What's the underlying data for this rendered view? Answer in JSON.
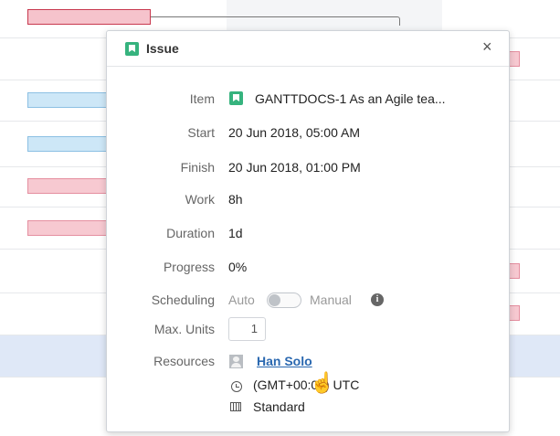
{
  "dialog": {
    "title": "Issue",
    "close_label": "×"
  },
  "fields": {
    "item": {
      "label": "Item",
      "value": "GANTTDOCS-1 As an Agile tea..."
    },
    "start": {
      "label": "Start",
      "value": "20 Jun 2018, 05:00 AM"
    },
    "finish": {
      "label": "Finish",
      "value": "20 Jun 2018, 01:00 PM"
    },
    "work": {
      "label": "Work",
      "value": "8h"
    },
    "duration": {
      "label": "Duration",
      "value": "1d"
    },
    "progress": {
      "label": "Progress",
      "value": "0%"
    },
    "scheduling": {
      "label": "Scheduling",
      "auto": "Auto",
      "manual": "Manual"
    },
    "max_units": {
      "label": "Max. Units",
      "value": "1"
    },
    "resources": {
      "label": "Resources",
      "name": "Han Solo",
      "timezone": "(GMT+00:00) UTC",
      "calendar": "Standard"
    }
  },
  "colors": {
    "issue_icon": "#36b37e",
    "link": "#2a68b0",
    "bar_red": "#f7c9d1",
    "bar_blue": "#cde7f7",
    "row_highlight": "#dfe8f7"
  },
  "icons": [
    "issue-icon",
    "close-icon",
    "info-icon",
    "avatar-icon",
    "clock-icon",
    "calendar-icon",
    "hand-cursor-icon"
  ]
}
